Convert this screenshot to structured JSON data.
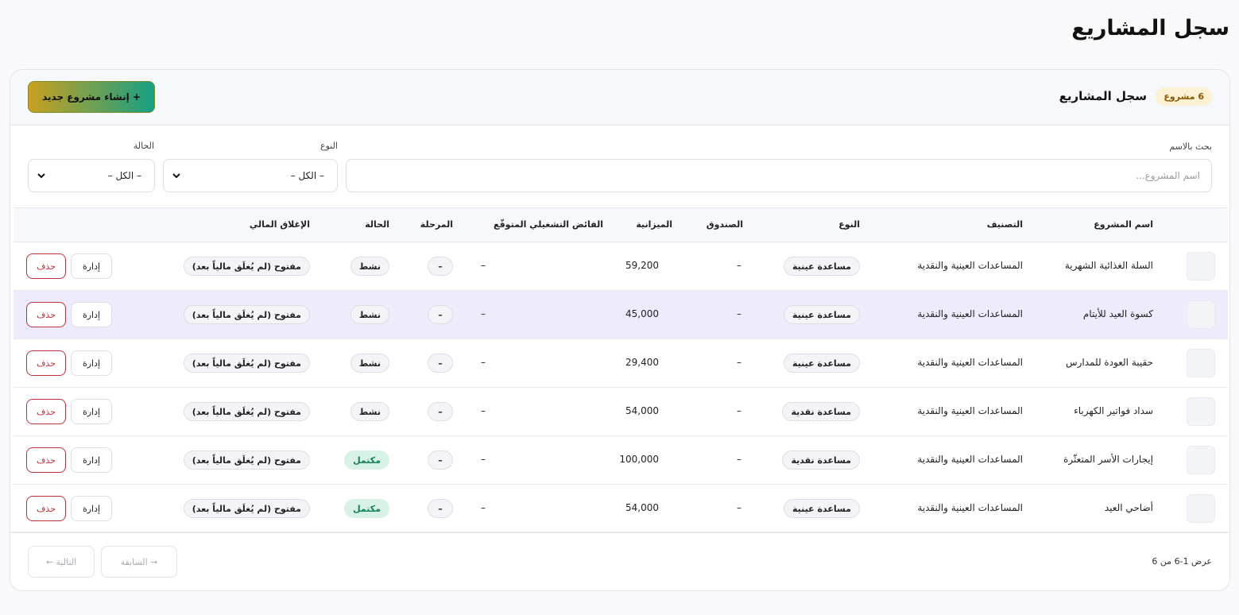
{
  "page_title": "سجل المشاريع",
  "header": {
    "count_badge": "6 مشروع",
    "title": "سجل المشاريع",
    "new_button": "+ إنشاء مشروع جديد"
  },
  "filters": {
    "search_label": "بحث بالاسم",
    "search_placeholder": "اسم المشروع...",
    "search_value": "",
    "type_label": "النوع",
    "type_value": "– الكل –",
    "status_label": "الحالة",
    "status_value": "– الكل –"
  },
  "table": {
    "headers": {
      "name": "اسم المشروع",
      "category": "التصنيف",
      "type": "النوع",
      "fund": "الصندوق",
      "budget": "الميزانية",
      "surplus": "الفائض التشغيلي المتوقّع",
      "stage": "المرحلة",
      "status": "الحالة",
      "closing": "الإغلاق المالي"
    },
    "rows": [
      {
        "name": "السلة الغذائية الشهرية",
        "category": "المساعدات العينية والنقدية",
        "type": "مساعدة عينية",
        "fund": "–",
        "budget": "59,200",
        "surplus": "–",
        "stage": "–",
        "status": "نشط",
        "status_kind": "active",
        "closing": "مفتوح (لم يُغلَق مالياً بعد)",
        "manage": "إدارة",
        "delete": "حذف"
      },
      {
        "name": "كسوة العيد للأيتام",
        "category": "المساعدات العينية والنقدية",
        "type": "مساعدة عينية",
        "fund": "–",
        "budget": "45,000",
        "surplus": "–",
        "stage": "–",
        "status": "نشط",
        "status_kind": "active",
        "closing": "مفتوح (لم يُغلَق مالياً بعد)",
        "manage": "إدارة",
        "delete": "حذف"
      },
      {
        "name": "حقيبة العودة للمدارس",
        "category": "المساعدات العينية والنقدية",
        "type": "مساعدة عينية",
        "fund": "–",
        "budget": "29,400",
        "surplus": "–",
        "stage": "–",
        "status": "نشط",
        "status_kind": "active",
        "closing": "مفتوح (لم يُغلَق مالياً بعد)",
        "manage": "إدارة",
        "delete": "حذف"
      },
      {
        "name": "سداد فواتير الكهرباء",
        "category": "المساعدات العينية والنقدية",
        "type": "مساعدة نقدية",
        "fund": "–",
        "budget": "54,000",
        "surplus": "–",
        "stage": "–",
        "status": "نشط",
        "status_kind": "active",
        "closing": "مفتوح (لم يُغلَق مالياً بعد)",
        "manage": "إدارة",
        "delete": "حذف"
      },
      {
        "name": "إيجارات الأسر المتعثّرة",
        "category": "المساعدات العينية والنقدية",
        "type": "مساعدة نقدية",
        "fund": "–",
        "budget": "100,000",
        "surplus": "–",
        "stage": "–",
        "status": "مكتمل",
        "status_kind": "done",
        "closing": "مفتوح (لم يُغلَق مالياً بعد)",
        "manage": "إدارة",
        "delete": "حذف"
      },
      {
        "name": "أضاحي العيد",
        "category": "المساعدات العينية والنقدية",
        "type": "مساعدة عينية",
        "fund": "–",
        "budget": "54,000",
        "surplus": "–",
        "stage": "–",
        "status": "مكتمل",
        "status_kind": "done",
        "closing": "مفتوح (لم يُغلَق مالياً بعد)",
        "manage": "إدارة",
        "delete": "حذف"
      }
    ],
    "highlighted_row": 1
  },
  "footer": {
    "showing": "عرض 1-6 من 6",
    "prev_label": "→ السابقة",
    "next_label": "التالية ←"
  },
  "colors": {
    "accent_gold": "#c9a01f",
    "accent_green": "#16a085",
    "delete_red": "#c0303a",
    "done_green": "#12805b",
    "highlight_row": "#eeebfc"
  },
  "icons": {
    "select_arrow": "chevron-down-icon"
  }
}
